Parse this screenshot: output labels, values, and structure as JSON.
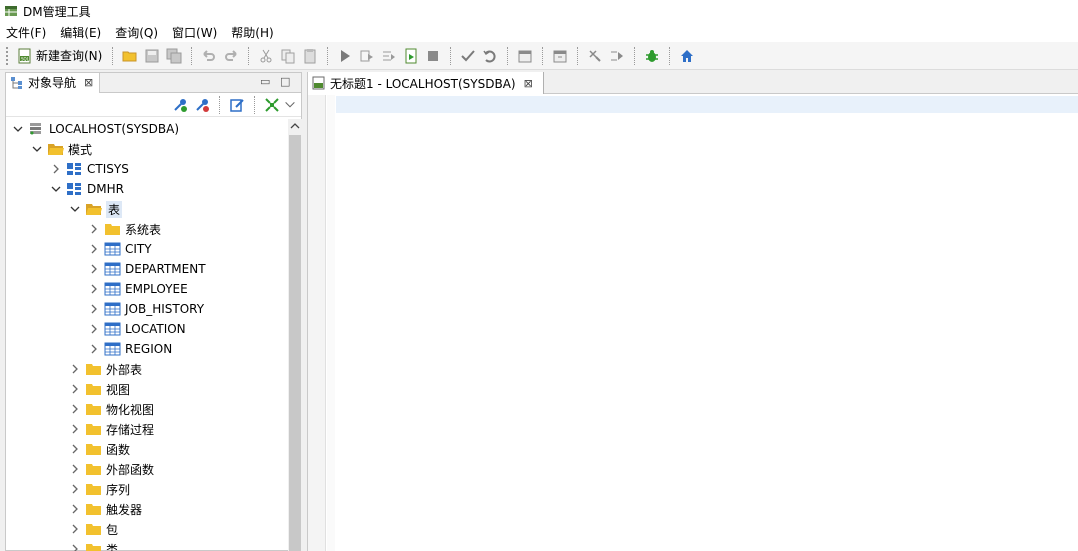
{
  "app": {
    "title": "DM管理工具"
  },
  "menu": [
    "文件(F)",
    "编辑(E)",
    "查询(Q)",
    "窗口(W)",
    "帮助(H)"
  ],
  "toolbar": {
    "new_query_label": "新建查询(N)"
  },
  "nav": {
    "tab_label": "对象导航",
    "close_glyph": "⊠",
    "minimize_glyph": "▭",
    "maximize_glyph": "□",
    "tree": [
      {
        "label": "LOCALHOST(SYSDBA)",
        "level": 0,
        "icon": "server-icon",
        "expand": "down"
      },
      {
        "label": "模式",
        "level": 1,
        "icon": "folder-open-icon",
        "expand": "down"
      },
      {
        "label": "CTISYS",
        "level": 2,
        "icon": "schema-icon",
        "expand": "right"
      },
      {
        "label": "DMHR",
        "level": 2,
        "icon": "schema-icon",
        "expand": "down"
      },
      {
        "label": "表",
        "level": 3,
        "icon": "folder-open-icon",
        "expand": "down",
        "selected": true
      },
      {
        "label": "系统表",
        "level": 4,
        "icon": "folder-icon",
        "expand": "right"
      },
      {
        "label": "CITY",
        "level": 4,
        "icon": "table-icon",
        "expand": "right"
      },
      {
        "label": "DEPARTMENT",
        "level": 4,
        "icon": "table-icon",
        "expand": "right"
      },
      {
        "label": "EMPLOYEE",
        "level": 4,
        "icon": "table-icon",
        "expand": "right"
      },
      {
        "label": "JOB_HISTORY",
        "level": 4,
        "icon": "table-icon",
        "expand": "right"
      },
      {
        "label": "LOCATION",
        "level": 4,
        "icon": "table-icon",
        "expand": "right"
      },
      {
        "label": "REGION",
        "level": 4,
        "icon": "table-icon",
        "expand": "right"
      },
      {
        "label": "外部表",
        "level": 3,
        "icon": "folder-icon",
        "expand": "right"
      },
      {
        "label": "视图",
        "level": 3,
        "icon": "folder-icon",
        "expand": "right"
      },
      {
        "label": "物化视图",
        "level": 3,
        "icon": "folder-icon",
        "expand": "right"
      },
      {
        "label": "存储过程",
        "level": 3,
        "icon": "folder-icon",
        "expand": "right"
      },
      {
        "label": "函数",
        "level": 3,
        "icon": "folder-icon",
        "expand": "right"
      },
      {
        "label": "外部函数",
        "level": 3,
        "icon": "folder-icon",
        "expand": "right"
      },
      {
        "label": "序列",
        "level": 3,
        "icon": "folder-icon",
        "expand": "right"
      },
      {
        "label": "触发器",
        "level": 3,
        "icon": "folder-icon",
        "expand": "right"
      },
      {
        "label": "包",
        "level": 3,
        "icon": "folder-icon",
        "expand": "right"
      },
      {
        "label": "类",
        "level": 3,
        "icon": "folder-icon",
        "expand": "right"
      }
    ]
  },
  "editor": {
    "tab_label": "无标题1 - LOCALHOST(SYSDBA)",
    "close_glyph": "⊠"
  },
  "colors": {
    "folder": "#f2c12e",
    "table": "#2f6fc7",
    "run": "#505050",
    "bug": "#2e9b2e",
    "home": "#2e6fc7"
  }
}
